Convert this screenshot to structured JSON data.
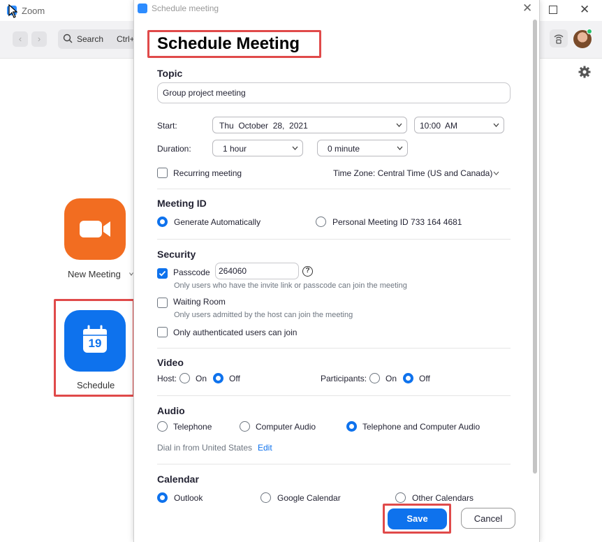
{
  "app": {
    "title": "Zoom"
  },
  "toolbar": {
    "search_label": "Search",
    "search_shortcut": "Ctrl+"
  },
  "home": {
    "new_meeting_label": "New Meeting",
    "schedule_label": "Schedule",
    "schedule_day": "19"
  },
  "colors": {
    "accent": "#0e72ed",
    "new_meeting": "#f26d21",
    "highlight": "#e04a4a"
  },
  "dialog": {
    "window_title": "Schedule meeting",
    "heading": "Schedule Meeting",
    "topic": {
      "label": "Topic",
      "value": "Group project meeting"
    },
    "start": {
      "label": "Start:",
      "date": "Thu  October  28,  2021",
      "time": "10:00  AM"
    },
    "duration": {
      "label": "Duration:",
      "hours": "1 hour",
      "minutes": "0 minute"
    },
    "recurring": {
      "label": "Recurring meeting",
      "checked": false
    },
    "timezone": "Time Zone: Central Time (US and Canada)",
    "meeting_id": {
      "title": "Meeting ID",
      "options": [
        "Generate Automatically",
        "Personal Meeting ID 733 164 4681"
      ],
      "selected": "Generate Automatically"
    },
    "security": {
      "title": "Security",
      "passcode_label": "Passcode",
      "passcode_value": "264060",
      "passcode_hint": "Only users who have the invite link or passcode can join the meeting",
      "waiting_room_label": "Waiting Room",
      "waiting_room_hint": "Only users admitted by the host can join the meeting",
      "auth_label": "Only authenticated users can join"
    },
    "video": {
      "title": "Video",
      "host_label": "Host:",
      "participants_label": "Participants:",
      "on_label": "On",
      "off_label": "Off",
      "host": "Off",
      "participants": "Off"
    },
    "audio": {
      "title": "Audio",
      "options": [
        "Telephone",
        "Computer Audio",
        "Telephone and Computer Audio"
      ],
      "selected": "Telephone and Computer Audio",
      "dial_in": "Dial in from United States",
      "edit_label": "Edit"
    },
    "calendar": {
      "title": "Calendar",
      "options": [
        "Outlook",
        "Google Calendar",
        "Other Calendars"
      ],
      "selected": "Outlook"
    },
    "save_label": "Save",
    "cancel_label": "Cancel"
  }
}
